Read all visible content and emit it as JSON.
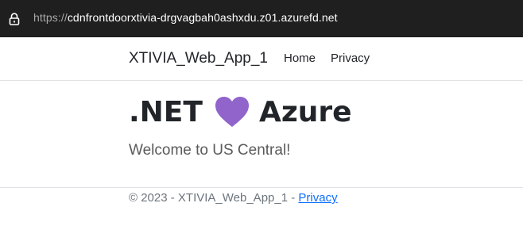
{
  "browser": {
    "url_scheme": "https://",
    "url_host": "cdnfrontdoorxtivia-drgvagbah0ashxdu.z01.azurefd.net"
  },
  "navbar": {
    "brand": "XTIVIA_Web_App_1",
    "links": [
      {
        "label": "Home"
      },
      {
        "label": "Privacy"
      }
    ]
  },
  "hero": {
    "left_text": ".NET",
    "icon": "heart-icon",
    "right_text": "Azure",
    "heart_color": "#9164cc"
  },
  "welcome": "Welcome to US Central!",
  "footer": {
    "copyright": "© 2023 - XTIVIA_Web_App_1 - ",
    "privacy_link": "Privacy"
  }
}
